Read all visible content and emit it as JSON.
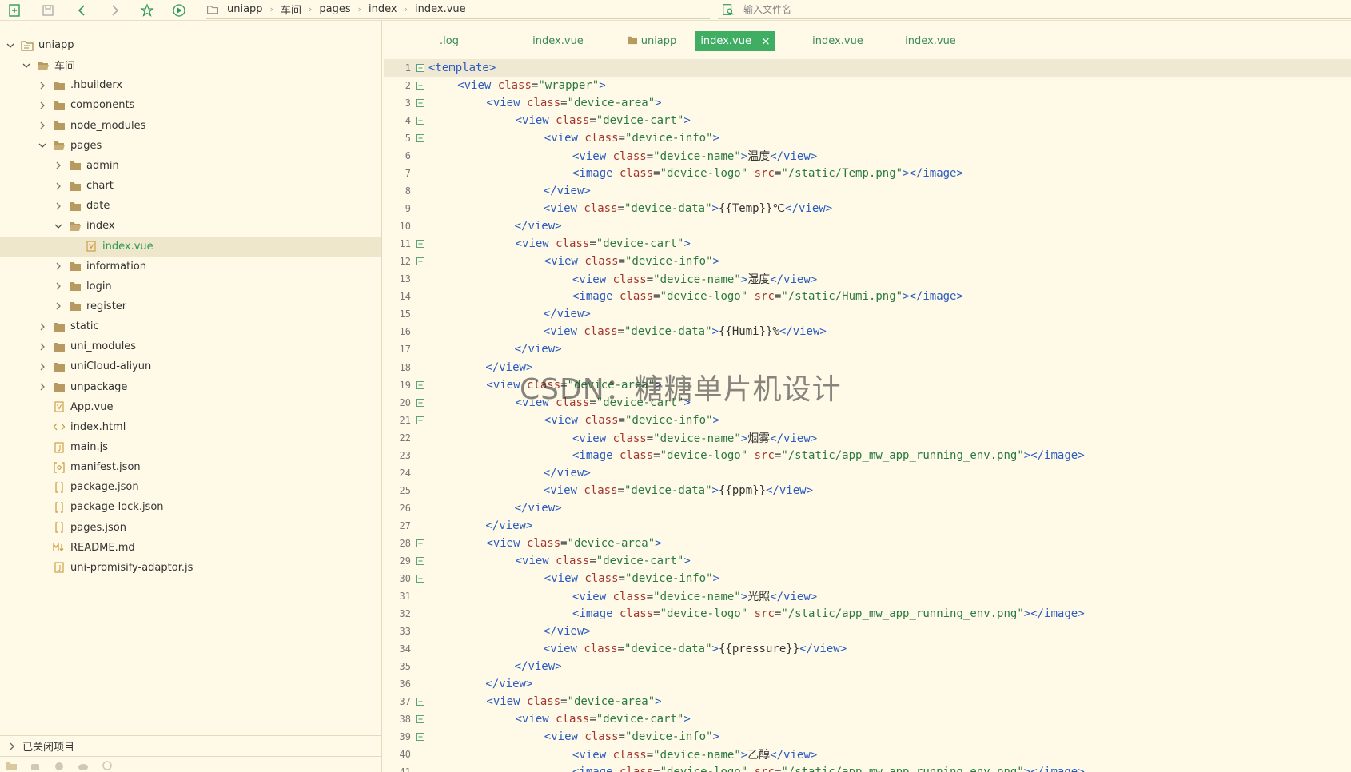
{
  "toolbar": {
    "icons": [
      "new-file-icon",
      "save-icon",
      "back-icon",
      "forward-icon",
      "star-icon",
      "run-icon"
    ]
  },
  "breadcrumb": {
    "items": [
      "uniapp",
      "车间",
      "pages",
      "index",
      "index.vue"
    ]
  },
  "file_search": {
    "placeholder": "输入文件名"
  },
  "sidebar": {
    "tree": [
      {
        "label": "uniapp",
        "depth": 0,
        "expanded": true,
        "type": "project"
      },
      {
        "label": "车间",
        "depth": 1,
        "expanded": true,
        "type": "folder-open"
      },
      {
        "label": ".hbuilderx",
        "depth": 2,
        "expanded": false,
        "type": "folder"
      },
      {
        "label": "components",
        "depth": 2,
        "expanded": false,
        "type": "folder"
      },
      {
        "label": "node_modules",
        "depth": 2,
        "expanded": false,
        "type": "folder"
      },
      {
        "label": "pages",
        "depth": 2,
        "expanded": true,
        "type": "folder-open"
      },
      {
        "label": "admin",
        "depth": 3,
        "expanded": false,
        "type": "folder"
      },
      {
        "label": "chart",
        "depth": 3,
        "expanded": false,
        "type": "folder"
      },
      {
        "label": "date",
        "depth": 3,
        "expanded": false,
        "type": "folder"
      },
      {
        "label": "index",
        "depth": 3,
        "expanded": true,
        "type": "folder-open"
      },
      {
        "label": "index.vue",
        "depth": 4,
        "type": "vue",
        "selected": true
      },
      {
        "label": "information",
        "depth": 3,
        "expanded": false,
        "type": "folder"
      },
      {
        "label": "login",
        "depth": 3,
        "expanded": false,
        "type": "folder"
      },
      {
        "label": "register",
        "depth": 3,
        "expanded": false,
        "type": "folder"
      },
      {
        "label": "static",
        "depth": 2,
        "expanded": false,
        "type": "folder"
      },
      {
        "label": "uni_modules",
        "depth": 2,
        "expanded": false,
        "type": "folder"
      },
      {
        "label": "uniCloud-aliyun",
        "depth": 2,
        "expanded": false,
        "type": "folder"
      },
      {
        "label": "unpackage",
        "depth": 2,
        "expanded": false,
        "type": "folder"
      },
      {
        "label": "App.vue",
        "depth": 2,
        "type": "vue"
      },
      {
        "label": "index.html",
        "depth": 2,
        "type": "html"
      },
      {
        "label": "main.js",
        "depth": 2,
        "type": "js"
      },
      {
        "label": "manifest.json",
        "depth": 2,
        "type": "manifest"
      },
      {
        "label": "package.json",
        "depth": 2,
        "type": "json"
      },
      {
        "label": "package-lock.json",
        "depth": 2,
        "type": "json"
      },
      {
        "label": "pages.json",
        "depth": 2,
        "type": "json"
      },
      {
        "label": "README.md",
        "depth": 2,
        "type": "md"
      },
      {
        "label": "uni-promisify-adaptor.js",
        "depth": 2,
        "type": "js"
      }
    ],
    "closed_projects_label": "已关闭项目"
  },
  "tabs": [
    {
      "label": ".log",
      "active": false
    },
    {
      "label": "index.vue",
      "active": false
    },
    {
      "label": "uniapp",
      "active": false,
      "folder": true
    },
    {
      "label": "index.vue",
      "active": true
    },
    {
      "label": "index.vue",
      "active": false
    },
    {
      "label": "index.vue",
      "active": false
    }
  ],
  "tab_close_glyph": "×",
  "editor": {
    "lines": [
      {
        "n": "1",
        "fold": true,
        "indent": 0,
        "code": "<template>"
      },
      {
        "n": "2",
        "fold": true,
        "indent": 1,
        "code": "<view class=\"wrapper\">"
      },
      {
        "n": "3",
        "fold": true,
        "indent": 2,
        "code": "<view class=\"device-area\">"
      },
      {
        "n": "4",
        "fold": true,
        "indent": 3,
        "code": "<view class=\"device-cart\">"
      },
      {
        "n": "5",
        "fold": true,
        "indent": 4,
        "code": "<view class=\"device-info\">"
      },
      {
        "n": "6",
        "fold": false,
        "indent": 5,
        "code": "<view class=\"device-name\">温度</view>"
      },
      {
        "n": "7",
        "fold": false,
        "indent": 5,
        "code": "<image class=\"device-logo\" src=\"/static/Temp.png\"></image>"
      },
      {
        "n": "8",
        "fold": false,
        "indent": 4,
        "code": "</view>"
      },
      {
        "n": "9",
        "fold": false,
        "indent": 4,
        "code": "<view class=\"device-data\">{{Temp}}℃</view>"
      },
      {
        "n": "10",
        "fold": false,
        "indent": 3,
        "code": "</view>"
      },
      {
        "n": "11",
        "fold": true,
        "indent": 3,
        "code": "<view class=\"device-cart\">"
      },
      {
        "n": "12",
        "fold": true,
        "indent": 4,
        "code": "<view class=\"device-info\">"
      },
      {
        "n": "13",
        "fold": false,
        "indent": 5,
        "code": "<view class=\"device-name\">湿度</view>"
      },
      {
        "n": "14",
        "fold": false,
        "indent": 5,
        "code": "<image class=\"device-logo\" src=\"/static/Humi.png\"></image>"
      },
      {
        "n": "15",
        "fold": false,
        "indent": 4,
        "code": "</view>"
      },
      {
        "n": "16",
        "fold": false,
        "indent": 4,
        "code": "<view class=\"device-data\">{{Humi}}%</view>"
      },
      {
        "n": "17",
        "fold": false,
        "indent": 3,
        "code": "</view>"
      },
      {
        "n": "18",
        "fold": false,
        "indent": 2,
        "code": "</view>"
      },
      {
        "n": "19",
        "fold": true,
        "indent": 2,
        "code": "<view class=\"device-area\">"
      },
      {
        "n": "20",
        "fold": true,
        "indent": 3,
        "code": "<view class=\"device-cart\">"
      },
      {
        "n": "21",
        "fold": true,
        "indent": 4,
        "code": "<view class=\"device-info\">"
      },
      {
        "n": "22",
        "fold": false,
        "indent": 5,
        "code": "<view class=\"device-name\">烟雾</view>"
      },
      {
        "n": "23",
        "fold": false,
        "indent": 5,
        "code": "<image class=\"device-logo\" src=\"/static/app_mw_app_running_env.png\"></image>"
      },
      {
        "n": "24",
        "fold": false,
        "indent": 4,
        "code": "</view>"
      },
      {
        "n": "25",
        "fold": false,
        "indent": 4,
        "code": "<view class=\"device-data\">{{ppm}}</view>"
      },
      {
        "n": "26",
        "fold": false,
        "indent": 3,
        "code": "</view>"
      },
      {
        "n": "27",
        "fold": false,
        "indent": 2,
        "code": "</view>"
      },
      {
        "n": "28",
        "fold": true,
        "indent": 2,
        "code": "<view class=\"device-area\">"
      },
      {
        "n": "29",
        "fold": true,
        "indent": 3,
        "code": "<view class=\"device-cart\">"
      },
      {
        "n": "30",
        "fold": true,
        "indent": 4,
        "code": "<view class=\"device-info\">"
      },
      {
        "n": "31",
        "fold": false,
        "indent": 5,
        "code": "<view class=\"device-name\">光照</view>"
      },
      {
        "n": "32",
        "fold": false,
        "indent": 5,
        "code": "<image class=\"device-logo\" src=\"/static/app_mw_app_running_env.png\"></image>"
      },
      {
        "n": "33",
        "fold": false,
        "indent": 4,
        "code": "</view>"
      },
      {
        "n": "34",
        "fold": false,
        "indent": 4,
        "code": "<view class=\"device-data\">{{pressure}}</view>"
      },
      {
        "n": "35",
        "fold": false,
        "indent": 3,
        "code": "</view>"
      },
      {
        "n": "36",
        "fold": false,
        "indent": 2,
        "code": "</view>"
      },
      {
        "n": "37",
        "fold": true,
        "indent": 2,
        "code": "<view class=\"device-area\">"
      },
      {
        "n": "38",
        "fold": true,
        "indent": 3,
        "code": "<view class=\"device-cart\">"
      },
      {
        "n": "39",
        "fold": true,
        "indent": 4,
        "code": "<view class=\"device-info\">"
      },
      {
        "n": "40",
        "fold": false,
        "indent": 5,
        "code": "<view class=\"device-name\">乙醇</view>"
      },
      {
        "n": "41",
        "fold": false,
        "indent": 5,
        "code": "<image class=\"device-logo\" src=\"/static/app_mw_app_running_env.png\"></image>"
      }
    ]
  },
  "watermark": "CSDN：糖糖单片机设计",
  "colors": {
    "background": "#fffae8",
    "accent": "#3fae63",
    "tag": "#2a5bc0",
    "attr": "#a3372f",
    "string": "#2a7a40"
  }
}
